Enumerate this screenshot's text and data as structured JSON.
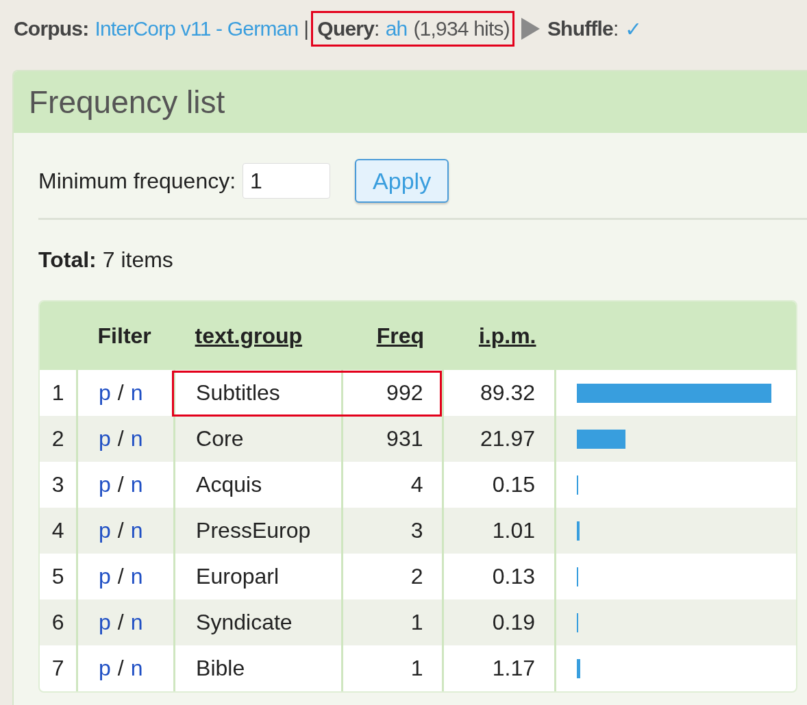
{
  "header": {
    "corpus_label": "Corpus:",
    "corpus": "InterCorp v11 - German",
    "separator": "|",
    "query_label": "Query",
    "query_colon": ":",
    "query": "ah",
    "hits": "(1,934 hits)",
    "query_highlighted": true,
    "shuffle_label": "Shuffle",
    "shuffle_colon": ":",
    "shuffle": "✓"
  },
  "panel": {
    "title": "Frequency list",
    "min_freq_label": "Minimum frequency:",
    "min_freq_value": "1",
    "apply": "Apply",
    "total_label": "Total:",
    "total": "7 items"
  },
  "table": {
    "columns": [
      "Filter",
      "text.group",
      "Freq",
      "i.p.m."
    ],
    "rows": [
      {
        "num": "1",
        "p": "p",
        "slash": "/",
        "n": "n",
        "group": "Subtitles",
        "freq": "992",
        "ipm": "89.32",
        "highlighted": true
      },
      {
        "num": "2",
        "p": "p",
        "slash": "/",
        "n": "n",
        "group": "Core",
        "freq": "931",
        "ipm": "21.97",
        "highlighted": false
      },
      {
        "num": "3",
        "p": "p",
        "slash": "/",
        "n": "n",
        "group": "Acquis",
        "freq": "4",
        "ipm": "0.15",
        "highlighted": false
      },
      {
        "num": "4",
        "p": "p",
        "slash": "/",
        "n": "n",
        "group": "PressEurop",
        "freq": "3",
        "ipm": "1.01",
        "highlighted": false
      },
      {
        "num": "5",
        "p": "p",
        "slash": "/",
        "n": "n",
        "group": "Europarl",
        "freq": "2",
        "ipm": "0.13",
        "highlighted": false
      },
      {
        "num": "6",
        "p": "p",
        "slash": "/",
        "n": "n",
        "group": "Syndicate",
        "freq": "1",
        "ipm": "0.19",
        "highlighted": false
      },
      {
        "num": "7",
        "p": "p",
        "slash": "/",
        "n": "n",
        "group": "Bible",
        "freq": "1",
        "ipm": "1.17",
        "highlighted": false
      }
    ]
  }
}
